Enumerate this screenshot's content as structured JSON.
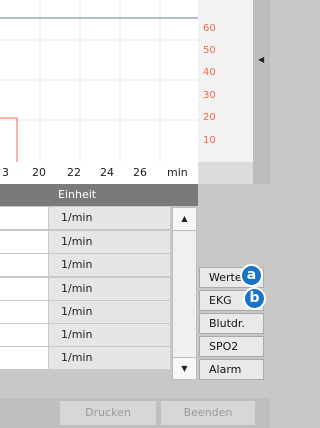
{
  "chart": {
    "scale_labels": [
      "60",
      "50",
      "40",
      "30",
      "20",
      "10"
    ],
    "x_ticks": [
      "3",
      "20",
      "22",
      "24",
      "26",
      "min"
    ],
    "accent_color": "#ee6b4d",
    "grid_color": "#d8e4f0"
  },
  "table": {
    "header": "Einheit",
    "rows": [
      {
        "unit": "1/min"
      },
      {
        "unit": "1/min"
      },
      {
        "unit": "1/min"
      },
      {
        "unit": "1/min"
      },
      {
        "unit": "1/min"
      },
      {
        "unit": "1/min"
      },
      {
        "unit": "1/min"
      }
    ]
  },
  "side_menu": {
    "items": [
      {
        "label": "Werte",
        "badge": "a"
      },
      {
        "label": "EKG",
        "badge": "b"
      },
      {
        "label": "Blutdr."
      },
      {
        "label": "SPO2"
      },
      {
        "label": "Alarm"
      }
    ]
  },
  "footer": {
    "print_label": "Drucken",
    "exit_label": "Beenden"
  },
  "icons": {
    "right_arrow": "triangle-left",
    "scroll_up": "triangle-up",
    "scroll_down": "triangle-down"
  },
  "colors": {
    "badge": "#1a73c7",
    "header": "#7a7a7a"
  }
}
